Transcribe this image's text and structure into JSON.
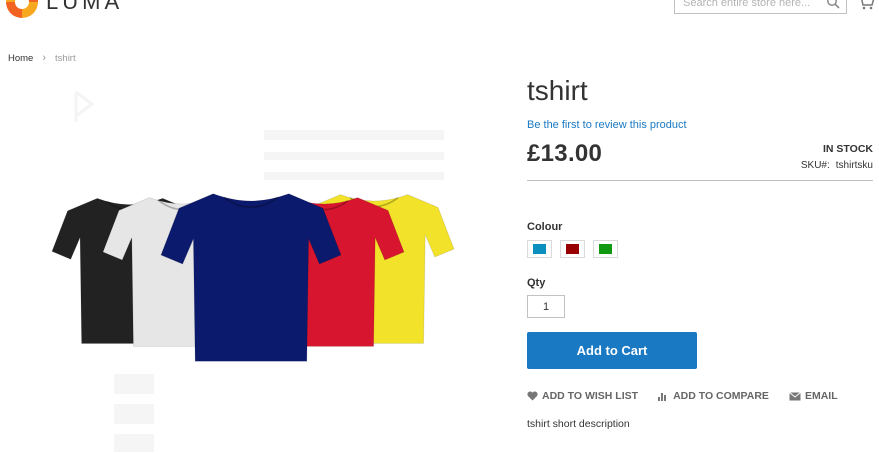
{
  "header": {
    "logo_text": "LUMA",
    "search_placeholder": "Search entire store here...",
    "icons": {
      "search": "search-icon",
      "cart": "cart-icon"
    }
  },
  "breadcrumb": {
    "home": "Home",
    "separator": "›",
    "current": "tshirt"
  },
  "product": {
    "title": "tshirt",
    "review_link": "Be the first to review this product",
    "price": "£13.00",
    "stock": "IN STOCK",
    "sku_label": "SKU#:",
    "sku_value": "tshirtsku",
    "colour_label": "Colour",
    "swatches": [
      {
        "color": "#0a8fbf"
      },
      {
        "color": "#990000"
      },
      {
        "color": "#119911"
      }
    ],
    "qty_label": "Qty",
    "qty_value": "1",
    "add_to_cart": "Add to Cart",
    "actions": {
      "wishlist": "ADD TO WISH LIST",
      "compare": "ADD TO COMPARE",
      "email": "EMAIL"
    },
    "short_description": "tshirt short description"
  },
  "gallery": {
    "shirt_colors": [
      "#222222",
      "#e6e6e6",
      "#0c1a6e",
      "#d8152e",
      "#f2e22a"
    ]
  },
  "theme": {
    "accent": "#1979c3",
    "link": "#1979c3"
  }
}
